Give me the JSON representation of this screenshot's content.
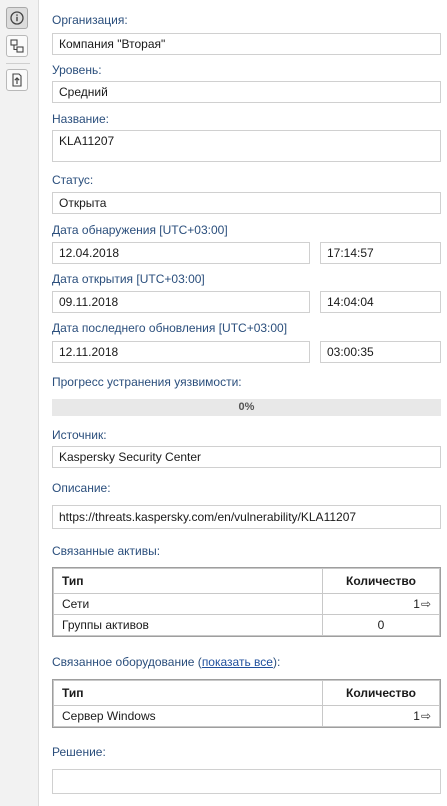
{
  "sidebar": {
    "icons": [
      "info-icon",
      "related-objects-icon",
      "export-icon"
    ]
  },
  "fields": {
    "organization_label": "Организация:",
    "organization_value": "Компания \"Вторая\"",
    "level_label": "Уровень:",
    "level_value": "Средний",
    "name_label": "Название:",
    "name_value": "KLA11207",
    "status_label": "Статус:",
    "status_value": "Открыта",
    "detected_label": "Дата обнаружения [UTC+03:00]",
    "detected_date": "12.04.2018",
    "detected_time": "17:14:57",
    "opened_label": "Дата открытия [UTC+03:00]",
    "opened_date": "09.11.2018",
    "opened_time": "14:04:04",
    "updated_label": "Дата последнего обновления [UTC+03:00]",
    "updated_date": "12.11.2018",
    "updated_time": "03:00:35",
    "progress_label": "Прогресс устранения уязвимости:",
    "progress_value": "0%",
    "progress_fraction": 0,
    "source_label": "Источник:",
    "source_value": "Kaspersky Security Center",
    "description_label": "Описание:",
    "description_value": "https://threats.kaspersky.com/en/vulnerability/KLA11207",
    "solution_label": "Решение:",
    "solution_value": ""
  },
  "related_assets": {
    "label": "Связанные активы:",
    "col_type": "Тип",
    "col_count": "Количество",
    "rows": [
      {
        "type": "Сети",
        "count": "1"
      },
      {
        "type": "Группы активов",
        "count": "0"
      }
    ]
  },
  "related_equipment": {
    "label_prefix": "Связанное оборудование (",
    "show_all_link": "показать все",
    "label_suffix": "):",
    "col_type": "Тип",
    "col_count": "Количество",
    "rows": [
      {
        "type": "Сервер Windows",
        "count": "1"
      }
    ]
  },
  "colors": {
    "label": "#2a4e7c",
    "link": "#1f4f9c",
    "sidebar_bg": "#f2f2f2"
  }
}
